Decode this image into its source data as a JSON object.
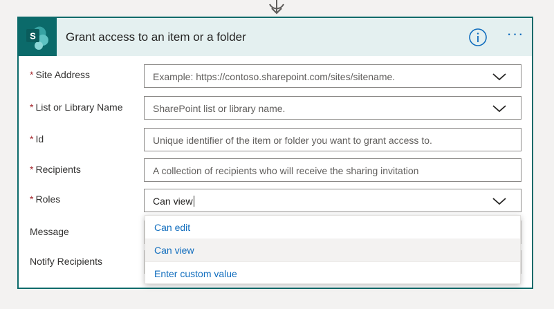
{
  "card": {
    "title": "Grant access to an item or a folder",
    "app_icon_letter": "S",
    "accent": "#0b6a6a",
    "header_bg": "#e4f0f0",
    "link_color": "#0f6cbd",
    "required_color": "#a4262c"
  },
  "fields": {
    "site_address": {
      "label": "Site Address",
      "required_mark": "*",
      "placeholder": "Example: https://contoso.sharepoint.com/sites/sitename."
    },
    "list_name": {
      "label": "List or Library Name",
      "required_mark": "*",
      "placeholder": "SharePoint list or library name."
    },
    "id": {
      "label": "Id",
      "required_mark": "*",
      "placeholder": "Unique identifier of the item or folder you want to grant access to."
    },
    "recipients": {
      "label": "Recipients",
      "required_mark": "*",
      "placeholder": "A collection of recipients who will receive the sharing invitation"
    },
    "roles": {
      "label": "Roles",
      "required_mark": "*",
      "value": "Can view"
    },
    "message": {
      "label": "Message"
    },
    "notify": {
      "label": "Notify Recipients"
    }
  },
  "dropdown": {
    "options": [
      "Can edit",
      "Can view"
    ],
    "selected": "Can view",
    "custom_value_label": "Enter custom value"
  }
}
